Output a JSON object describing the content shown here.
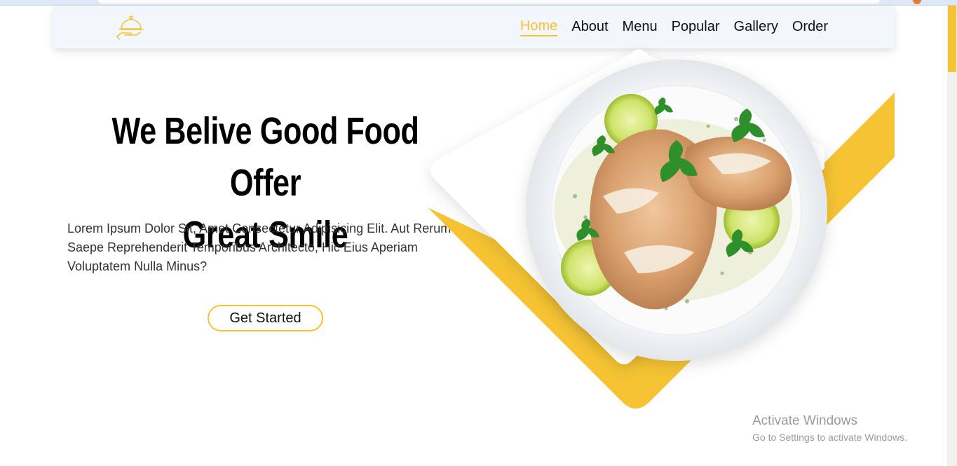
{
  "nav": {
    "logo_icon": "serving-cloche-icon",
    "items": [
      {
        "label": "Home",
        "active": true
      },
      {
        "label": "About",
        "active": false
      },
      {
        "label": "Menu",
        "active": false
      },
      {
        "label": "Popular",
        "active": false
      },
      {
        "label": "Gallery",
        "active": false
      },
      {
        "label": "Order",
        "active": false
      }
    ]
  },
  "hero": {
    "title_line1": "We Belive Good Food Offer",
    "title_line2": "Great Smile",
    "description": "Lorem Ipsum Dolor Sit, Amet Consectetur Adipisicing Elit. Aut Rerum Saepe Reprehenderit Temporibus Architecto, Hic Eius Aperiam Voluptatem Nulla Minus?",
    "cta_label": "Get Started",
    "image": "grilled-chicken-plate"
  },
  "watermark": {
    "line1": "Activate Windows",
    "line2": "Go to Settings to activate Windows."
  },
  "colors": {
    "accent": "#f5c333",
    "nav_bg": "#f1f7fd",
    "text": "#111111"
  }
}
